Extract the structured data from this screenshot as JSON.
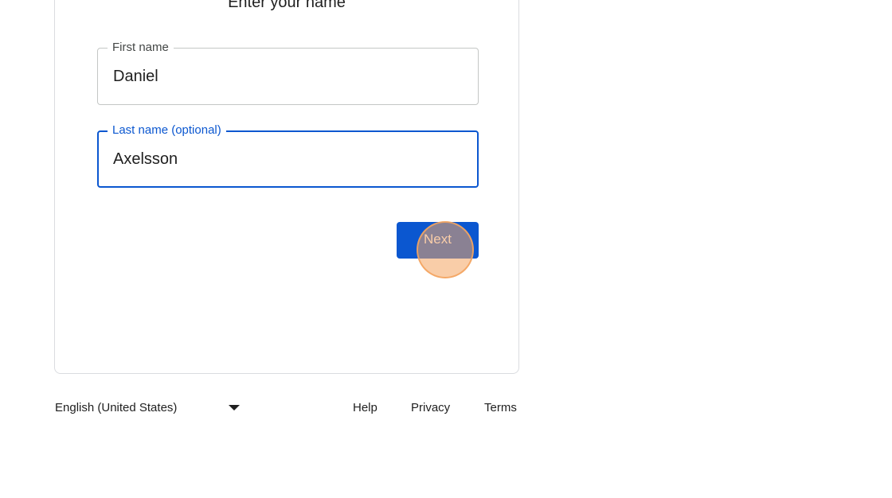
{
  "card": {
    "title": "Enter your name"
  },
  "form": {
    "first_name": {
      "label": "First name",
      "value": "Daniel"
    },
    "last_name": {
      "label": "Last name (optional)",
      "value": "Axelsson"
    },
    "next_label": "Next"
  },
  "footer": {
    "language": "English (United States)",
    "links": [
      "Help",
      "Privacy",
      "Terms"
    ]
  },
  "colors": {
    "accent": "#0b57d0",
    "border": "#dadce0",
    "click_marker": "#f4a460"
  }
}
